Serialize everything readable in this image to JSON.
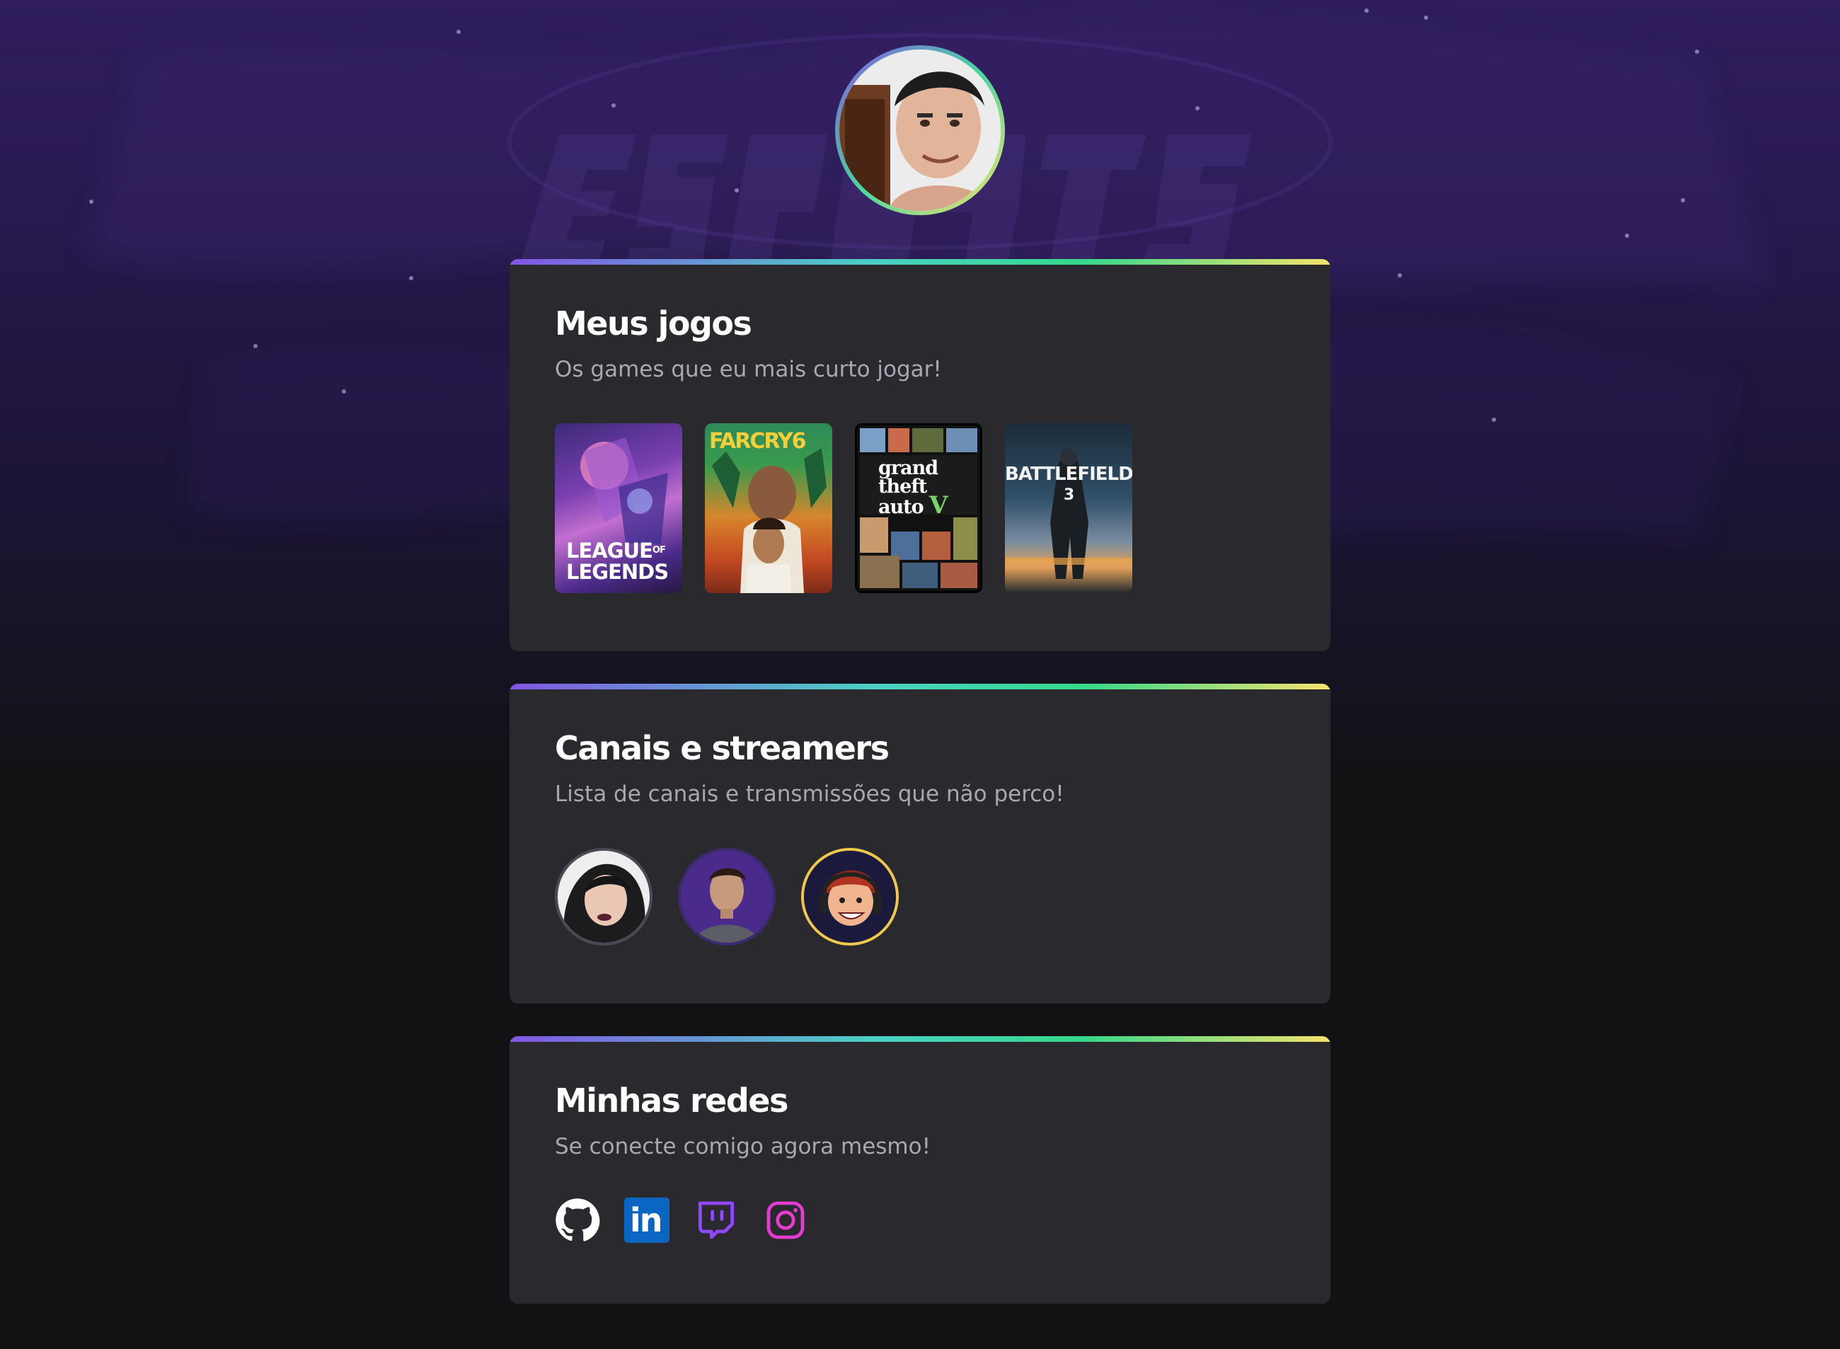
{
  "profile": {
    "avatar_alt": "Foto de perfil"
  },
  "sections": {
    "games": {
      "title": "Meus jogos",
      "subtitle": "Os games que eu mais curto jogar!",
      "items": [
        {
          "name": "League of Legends",
          "cover_text_1": "LEAGUE",
          "cover_text_of": "OF",
          "cover_text_2": "LEGENDS"
        },
        {
          "name": "Far Cry 6",
          "cover_text_1": "FARCRY6"
        },
        {
          "name": "Grand Theft Auto V",
          "cover_text_1": "grand",
          "cover_text_2": "theft",
          "cover_text_3": "auto",
          "cover_text_4": "V"
        },
        {
          "name": "Battlefield 3",
          "cover_text_1": "BATTLEFIELD",
          "cover_text_2": "3"
        }
      ]
    },
    "streamers": {
      "title": "Canais e streamers",
      "subtitle": "Lista de canais e transmissões que não perco!",
      "items": [
        {
          "name": "streamer-1"
        },
        {
          "name": "streamer-2"
        },
        {
          "name": "streamer-3"
        }
      ]
    },
    "socials": {
      "title": "Minhas redes",
      "subtitle": "Se conecte comigo agora mesmo!",
      "items": [
        {
          "name": "GitHub",
          "icon": "github-icon",
          "color": "#ffffff"
        },
        {
          "name": "LinkedIn",
          "icon": "linkedin-icon",
          "color": "#0a66c2",
          "label": "in"
        },
        {
          "name": "Twitch",
          "icon": "twitch-icon",
          "color": "#9146ff"
        },
        {
          "name": "Instagram",
          "icon": "instagram-icon",
          "color": "#e63bd0"
        }
      ]
    }
  },
  "colors": {
    "background": "#121214",
    "card": "#29292e",
    "accent_gradient": [
      "#8257e5",
      "#35d98a",
      "#f5e36b"
    ],
    "title": "#ffffff",
    "subtitle": "#a8a8b3"
  }
}
